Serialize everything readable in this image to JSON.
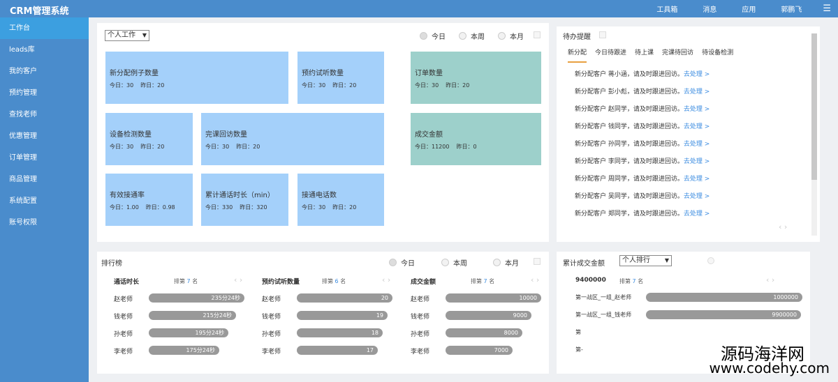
{
  "brand": "CRM管理系统",
  "topnav": {
    "items": [
      "工具箱",
      "消息",
      "应用",
      "郭鹏飞"
    ],
    "menu_icon": "☰"
  },
  "sidebar": {
    "items": [
      "工作台",
      "leads库",
      "我的客户",
      "预约管理",
      "查找老师",
      "优惠管理",
      "订单管理",
      "商品管理",
      "系统配置",
      "账号权限"
    ]
  },
  "work": {
    "select": "个人工作",
    "radios": [
      "今日",
      "本周",
      "本月"
    ],
    "cards": [
      {
        "title": "新分配例子数量",
        "today": "今日：30",
        "yday": "昨日：20"
      },
      {
        "title": "预约试听数量",
        "today": "今日：30",
        "yday": "昨日：20"
      },
      {
        "title": "订单数量",
        "today": "今日：30",
        "yday": "昨日：20"
      },
      {
        "title": "设备检测数量",
        "today": "今日：30",
        "yday": "昨日：20"
      },
      {
        "title": "完课回访数量",
        "today": "今日：30",
        "yday": "昨日：20"
      },
      {
        "title": "成交金额",
        "today": "今日：11200",
        "yday": "昨日：0"
      },
      {
        "title": "有效接通率",
        "today": "今日：1.00",
        "yday": "昨日：0.98"
      },
      {
        "title": "累计通话时长（min）",
        "today": "今日：330",
        "yday": "昨日：320"
      },
      {
        "title": "接通电话数",
        "today": "今日：30",
        "yday": "昨日：20"
      }
    ]
  },
  "todo": {
    "title": "待办提醒",
    "tabs": [
      "新分配",
      "今日待跟进",
      "待上课",
      "完课待回访",
      "待设备检测"
    ],
    "link": "去处理 >",
    "items": [
      "新分配客户 蒋小涵，请及时跟进回访。",
      "新分配客户 彭小彪，请及时跟进回访。",
      "新分配客户 赵同学，请及时跟进回访。",
      "新分配客户 钱同学，请及时跟进回访。",
      "新分配客户 孙同学，请及时跟进回访。",
      "新分配客户 李同学，请及时跟进回访。",
      "新分配客户 周同学，请及时跟进回访。",
      "新分配客户 吴同学，请及时跟进回访。",
      "新分配客户 郑同学，请及时跟进回访。"
    ]
  },
  "ranking": {
    "title": "排行榜",
    "radios": [
      "今日",
      "本周",
      "本月"
    ],
    "columns": [
      {
        "head": "通话时长",
        "rank_pre": "排第",
        "rank_num": "7",
        "rank_post": "名",
        "rows": [
          {
            "name": "赵老师",
            "value": "235分24秒",
            "pct": 100
          },
          {
            "name": "钱老师",
            "value": "215分24秒",
            "pct": 91
          },
          {
            "name": "孙老师",
            "value": "195分24秒",
            "pct": 83
          },
          {
            "name": "李老师",
            "value": "175分24秒",
            "pct": 74
          }
        ]
      },
      {
        "head": "预约试听数量",
        "rank_pre": "排第",
        "rank_num": "6",
        "rank_post": "名",
        "rows": [
          {
            "name": "赵老师",
            "value": "20",
            "pct": 100
          },
          {
            "name": "钱老师",
            "value": "19",
            "pct": 95
          },
          {
            "name": "孙老师",
            "value": "18",
            "pct": 90
          },
          {
            "name": "李老师",
            "value": "17",
            "pct": 85
          }
        ]
      },
      {
        "head": "成交金额",
        "rank_pre": "排第",
        "rank_num": "7",
        "rank_post": "名",
        "rows": [
          {
            "name": "赵老师",
            "value": "10000",
            "pct": 100
          },
          {
            "name": "钱老师",
            "value": "9000",
            "pct": 90
          },
          {
            "name": "孙老师",
            "value": "8000",
            "pct": 80
          },
          {
            "name": "李老师",
            "value": "7000",
            "pct": 70
          }
        ]
      }
    ]
  },
  "total": {
    "title": "累计成交金额",
    "select": "个人排行",
    "amount": "9400000",
    "rank_pre": "排第",
    "rank_num": "7",
    "rank_post": "名",
    "rows": [
      {
        "name": "第一战区_一组_赵老师",
        "value": "1000000",
        "pct": 100
      },
      {
        "name": "第一战区_一组_钱老师",
        "value": "9900000",
        "pct": 99
      },
      {
        "name": "第",
        "value": "",
        "pct": 0
      },
      {
        "name": "第-",
        "value": "",
        "pct": 0
      }
    ]
  },
  "watermark": {
    "line1": "源码海洋网",
    "line2": "www.codehy.com"
  }
}
